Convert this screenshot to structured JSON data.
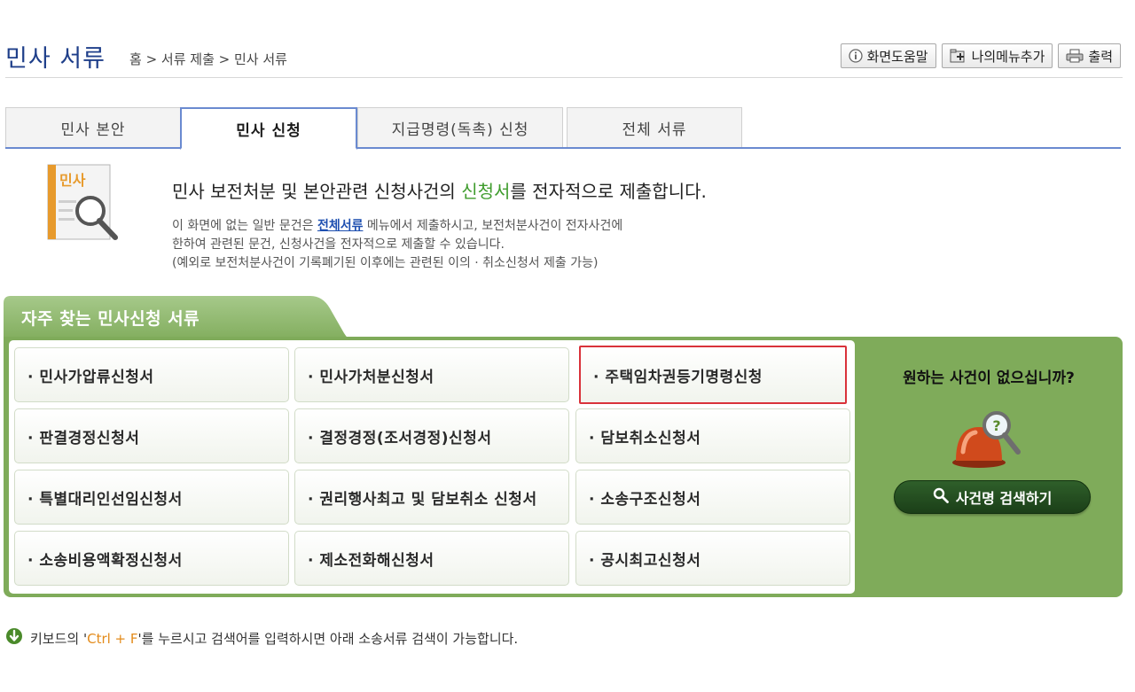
{
  "header": {
    "title": "민사 서류",
    "breadcrumb": "홈 > 서류 제출 > 민사 서류",
    "buttons": {
      "help": "화면도움말",
      "add_menu": "나의메뉴추가",
      "print": "출력"
    }
  },
  "tabs": [
    {
      "label": "민사 본안"
    },
    {
      "label": "민사 신청"
    },
    {
      "label": "지급명령(독촉) 신청"
    },
    {
      "label": "전체 서류"
    }
  ],
  "intro": {
    "icon_label": "민사",
    "heading_pre": "민사 보전처분 및 본안관련 신청사건의 ",
    "heading_hl": "신청서",
    "heading_post": "를 전자적으로 제출합니다.",
    "line1_pre": "이 화면에 없는 일반 문건은 ",
    "line1_link": "전체서류",
    "line1_post": " 메뉴에서 제출하시고, 보전처분사건이 전자사건에",
    "line2": "한하여 관련된 문건, 신청사건을 전자적으로 제출할 수 있습니다.",
    "line3": "(예외로 보전처분사건이 기록폐기된 이후에는 관련된 이의 · 취소신청서 제출 가능)"
  },
  "frequent": {
    "title": "자주 찾는 민사신청 서류",
    "items": [
      "· 민사가압류신청서",
      "· 민사가처분신청서",
      "· 주택임차권등기명령신청",
      "· 판결경정신청서",
      "· 결정경정(조서경정)신청서",
      "· 담보취소신청서",
      "· 특별대리인선임신청서",
      "· 권리행사최고 및 담보취소 신청서",
      "· 소송구조신청서",
      "· 소송비용액확정신청서",
      "· 제소전화해신청서",
      "· 공시최고신청서"
    ],
    "side_question": "원하는 사건이 없으십니까?",
    "search_button": "사건명 검색하기"
  },
  "hint": {
    "pre": "키보드의 '",
    "key": "Ctrl + F",
    "post": "'를 누르시고 검색어를 입력하시면 아래 소송서류 검색이 가능합니다."
  },
  "colors": {
    "title_blue": "#1f3f8a",
    "panel_green": "#7fab5a",
    "highlight_red": "#d9323a",
    "accent_green": "#3f9c2d",
    "key_orange": "#e38b1b"
  }
}
